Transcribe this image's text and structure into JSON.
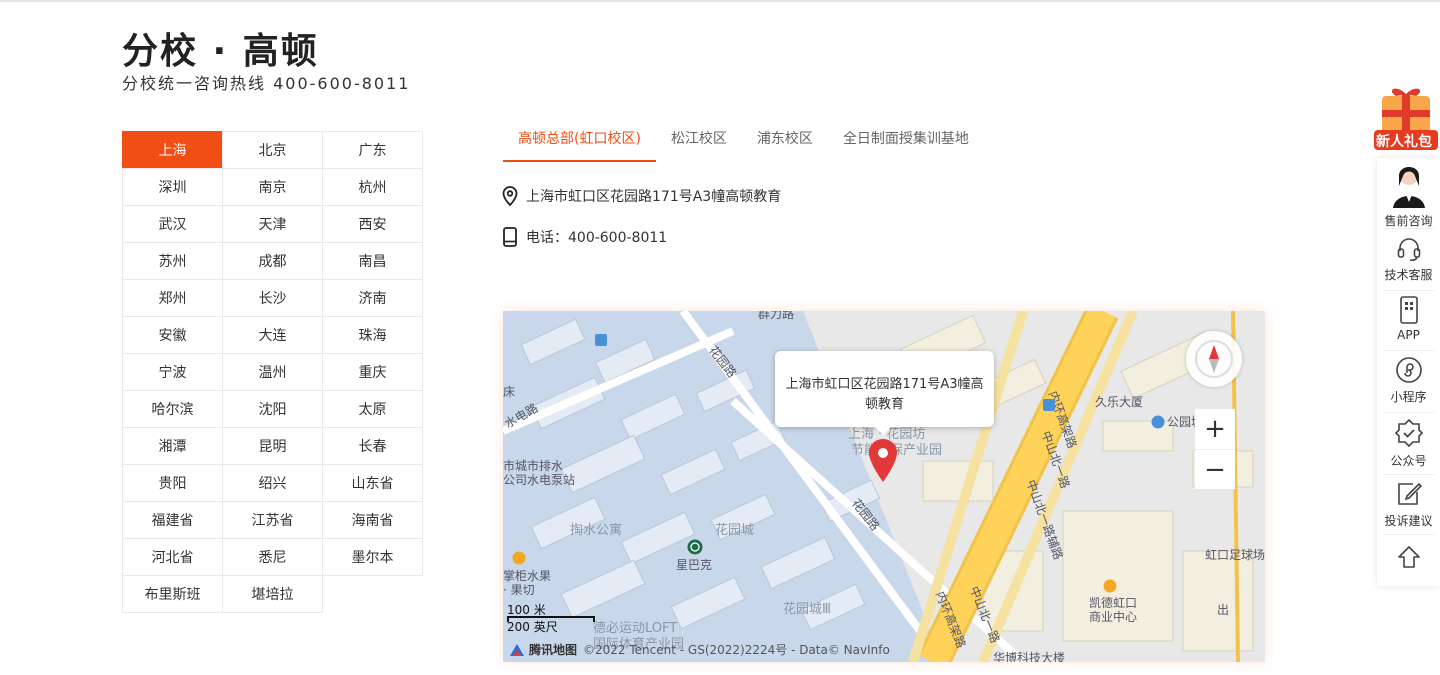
{
  "header": {
    "title": "分校 · 高顿",
    "subtitle": "分校统一咨询热线 400-600-8011"
  },
  "cities": [
    {
      "label": "上海",
      "active": true
    },
    {
      "label": "北京"
    },
    {
      "label": "广东"
    },
    {
      "label": "深圳"
    },
    {
      "label": "南京"
    },
    {
      "label": "杭州"
    },
    {
      "label": "武汉"
    },
    {
      "label": "天津"
    },
    {
      "label": "西安"
    },
    {
      "label": "苏州"
    },
    {
      "label": "成都"
    },
    {
      "label": "南昌"
    },
    {
      "label": "郑州"
    },
    {
      "label": "长沙"
    },
    {
      "label": "济南"
    },
    {
      "label": "安徽"
    },
    {
      "label": "大连"
    },
    {
      "label": "珠海"
    },
    {
      "label": "宁波"
    },
    {
      "label": "温州"
    },
    {
      "label": "重庆"
    },
    {
      "label": "哈尔滨"
    },
    {
      "label": "沈阳"
    },
    {
      "label": "太原"
    },
    {
      "label": "湘潭"
    },
    {
      "label": "昆明"
    },
    {
      "label": "长春"
    },
    {
      "label": "贵阳"
    },
    {
      "label": "绍兴"
    },
    {
      "label": "山东省"
    },
    {
      "label": "福建省"
    },
    {
      "label": "江苏省"
    },
    {
      "label": "海南省"
    },
    {
      "label": "河北省"
    },
    {
      "label": "悉尼"
    },
    {
      "label": "墨尔本"
    },
    {
      "label": "布里斯班"
    },
    {
      "label": "堪培拉"
    }
  ],
  "tabs": [
    {
      "label": "高顿总部(虹口校区)",
      "active": true
    },
    {
      "label": "松江校区"
    },
    {
      "label": "浦东校区"
    },
    {
      "label": "全日制面授集训基地"
    }
  ],
  "campus": {
    "address": "上海市虹口区花园路171号A3幢高顿教育",
    "phone": "电话：400-600-8011"
  },
  "map": {
    "popup": "上海市虹口区花园路171号A3幢高顿教育",
    "labels": {
      "huayuanlu1": "花园路",
      "huayuanlu2": "花园路",
      "nanchuan": "床",
      "shuidian": "水电路",
      "paishui1": "市城市排水",
      "paishui2": "公司水电泵站",
      "taoshui": "掏水公寓",
      "huayuancheng": "花园城",
      "huayuancheng3": "花园城Ⅲ",
      "starbucks": "星巴克",
      "fruit1": "掌柜水果",
      "fruit2": "· 果切",
      "loft1": "德必运动LOFT",
      "loft2": "国际体育产业园",
      "park1": "上海 · 花园坊",
      "park2": "节能环保产业园",
      "zhongshan1": "中山北一路",
      "zhongshan2": "中山北一路辅路",
      "neihuan1": "内环高架路",
      "neihuan2": "内环高架路",
      "zhongshan3": "中山北一路",
      "jiule": "久乐大厦",
      "gongyuan": "公园城",
      "kaide1": "凯德虹口",
      "kaide2": "商业中心",
      "hongkou": "虹口足球场",
      "huabo": "华博科技大楼",
      "chu": "出",
      "top": "群力路"
    },
    "zoom_in": "+",
    "zoom_out": "−",
    "scale_metric": "100 米",
    "scale_imperial": "200 英尺",
    "brand": "腾讯地图",
    "copyright": "©2022 Tencent - GS(2022)2224号 - Data© NavInfo"
  },
  "float_bar": {
    "gift": "新人礼包",
    "items": [
      {
        "label": "售前咨询",
        "icon": "consultant-avatar"
      },
      {
        "label": "技术客服",
        "icon": "headset-icon"
      },
      {
        "label": "APP",
        "icon": "app-icon"
      },
      {
        "label": "小程序",
        "icon": "mini-program-icon"
      },
      {
        "label": "公众号",
        "icon": "official-account-icon"
      },
      {
        "label": "投诉建议",
        "icon": "feedback-icon"
      }
    ]
  },
  "colors": {
    "accent": "#f04e15",
    "map_water": "#c9d7ea",
    "map_road": "#ffd25a"
  }
}
